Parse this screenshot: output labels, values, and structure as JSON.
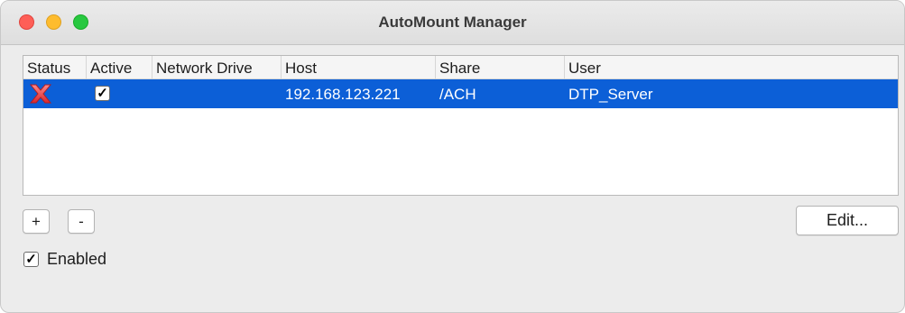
{
  "window": {
    "title": "AutoMount Manager"
  },
  "table": {
    "columns": [
      "Status",
      "Active",
      "Network Drive",
      "Host",
      "Share",
      "User"
    ],
    "rows": [
      {
        "status_icon": "red-x-icon",
        "active": true,
        "active_mark": "✓",
        "network_drive": "",
        "host": "192.168.123.221",
        "share": "/ACH",
        "user": "DTP_Server"
      }
    ],
    "selected_row_color": "#0c5fd7"
  },
  "buttons": {
    "add_label": "+",
    "remove_label": "-",
    "edit_label": "Edit..."
  },
  "options": {
    "enabled_label": "Enabled",
    "enabled_checked": true,
    "enabled_mark": "✓"
  },
  "colors": {
    "close": "#fe5f57",
    "minimize": "#febc2e",
    "maximize": "#28c840"
  }
}
